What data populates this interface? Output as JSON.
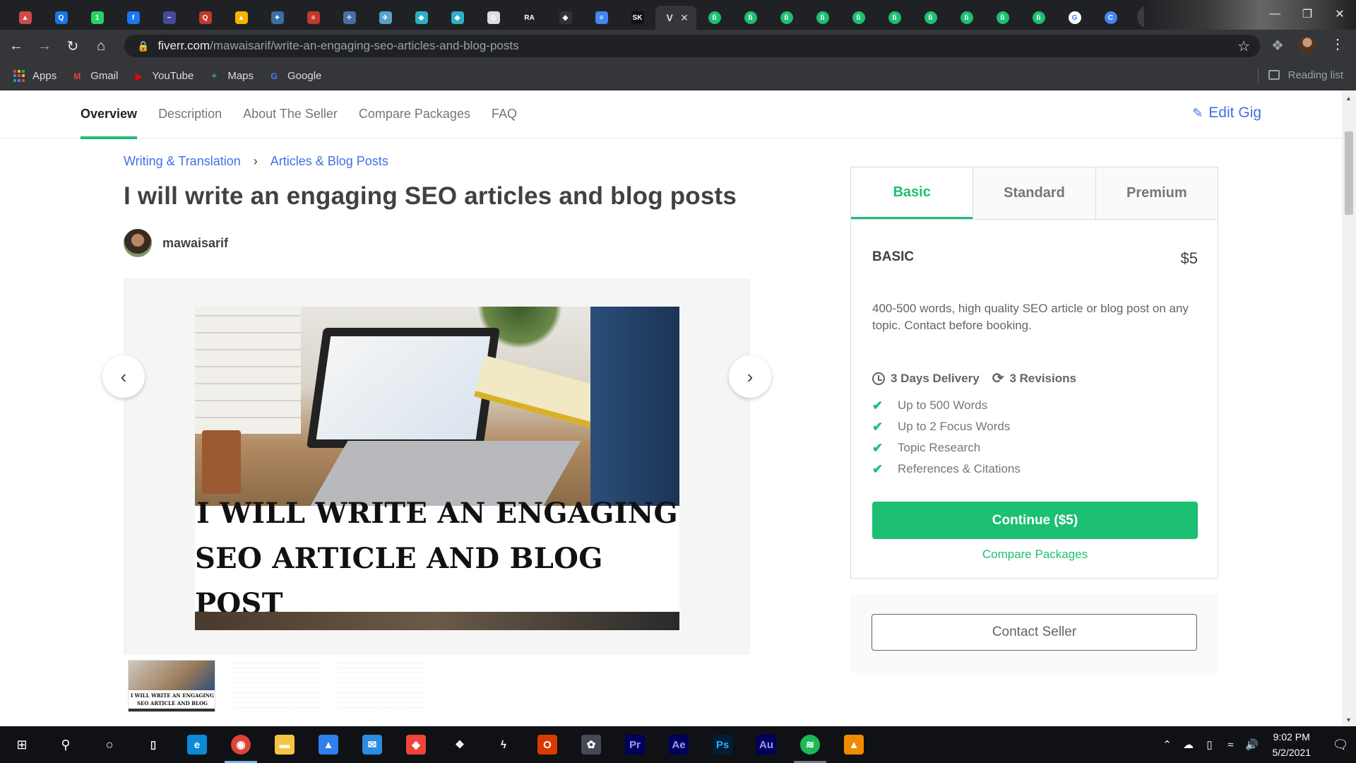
{
  "browser": {
    "tabs": [
      {
        "icon": "tab-favicon",
        "color": "#d04a4a",
        "glyph": "▲"
      },
      {
        "icon": "tab-favicon",
        "color": "#1a73e8",
        "glyph": "Q"
      },
      {
        "icon": "tab-favicon",
        "color": "#25d366",
        "glyph": "1"
      },
      {
        "icon": "tab-favicon",
        "color": "#1877f2",
        "glyph": "f"
      },
      {
        "icon": "tab-favicon",
        "color": "#444a9a",
        "glyph": "~"
      },
      {
        "icon": "tab-favicon",
        "color": "#c0392b",
        "glyph": "Q"
      },
      {
        "icon": "tab-favicon",
        "color": "#f4b400",
        "glyph": "▲"
      },
      {
        "icon": "tab-favicon",
        "color": "#3a6ea5",
        "glyph": "✦"
      },
      {
        "icon": "tab-favicon",
        "color": "#c0392b",
        "glyph": "≡"
      },
      {
        "icon": "tab-favicon",
        "color": "#4a6fa5",
        "glyph": "✧"
      },
      {
        "icon": "tab-favicon",
        "color": "#5aa0c8",
        "glyph": "✈"
      },
      {
        "icon": "tab-favicon",
        "color": "#2bb0c8",
        "glyph": "◆"
      },
      {
        "icon": "tab-favicon",
        "color": "#2bb0c8",
        "glyph": "◆"
      },
      {
        "icon": "tab-favicon",
        "color": "#dadce0",
        "glyph": "◎"
      },
      {
        "icon": "tab-favicon",
        "color": "#222222",
        "glyph": "RA"
      },
      {
        "icon": "tab-favicon",
        "color": "#333333",
        "glyph": "◆"
      },
      {
        "icon": "tab-favicon",
        "color": "#4285f4",
        "glyph": "≡"
      },
      {
        "icon": "tab-favicon",
        "color": "#111111",
        "glyph": "SK"
      }
    ],
    "active_tab_glyph": "V",
    "fiverr_tab_glyph": "fi",
    "fiverr_tab_count": 10,
    "trailing_tabs": [
      {
        "color": "#ffffff",
        "glyph": "G"
      },
      {
        "color": "#4285f4",
        "glyph": "C"
      }
    ],
    "url_domain": "fiverr.com",
    "url_path": "/mawaisarif/write-an-engaging-seo-articles-and-blog-posts",
    "bookmarks": [
      {
        "label": "Apps",
        "icon": "apps-grid-icon"
      },
      {
        "label": "Gmail",
        "icon": "gmail-icon"
      },
      {
        "label": "YouTube",
        "icon": "youtube-icon"
      },
      {
        "label": "Maps",
        "icon": "maps-icon"
      },
      {
        "label": "Google",
        "icon": "google-icon"
      }
    ],
    "reading_list": "Reading list"
  },
  "subnav": {
    "items": [
      "Overview",
      "Description",
      "About The Seller",
      "Compare Packages",
      "FAQ"
    ],
    "active": "Overview",
    "edit_gig": "Edit Gig"
  },
  "gig": {
    "breadcrumb": [
      "Writing & Translation",
      "Articles & Blog Posts"
    ],
    "title": "I will write an engaging SEO articles and blog posts",
    "seller_name": "mawaisarif",
    "image_caption_line1": "I WILL WRITE AN ENGAGING",
    "image_caption_line2": "SEO ARTICLE AND BLOG POST",
    "thumb_caption_line1": "I WILL WRITE AN ENGAGING",
    "thumb_caption_line2": "SEO ARTICLE AND BLOG POST"
  },
  "package": {
    "tabs": [
      "Basic",
      "Standard",
      "Premium"
    ],
    "active_tab": "Basic",
    "name": "BASIC",
    "price": "$5",
    "description": "400-500 words, high quality SEO article or blog post on any topic. Contact before booking.",
    "delivery": "3 Days Delivery",
    "revisions": "3 Revisions",
    "features": [
      "Up to 500 Words",
      "Up to 2 Focus Words",
      "Topic Research",
      "References & Citations"
    ],
    "continue_label": "Continue ($5)",
    "compare_label": "Compare Packages",
    "contact_label": "Contact Seller"
  },
  "colors": {
    "fiverr_green": "#1dbf73",
    "link_blue": "#446ee7"
  },
  "taskbar": {
    "apps": [
      {
        "name": "task-view",
        "glyph": "▯",
        "color": "#0f1115"
      },
      {
        "name": "edge",
        "glyph": "e",
        "color": "#0c8ad6"
      },
      {
        "name": "chrome",
        "glyph": "◉",
        "color": "#db4437"
      },
      {
        "name": "file-explorer",
        "glyph": "▬",
        "color": "#f4c542"
      },
      {
        "name": "app-blue",
        "glyph": "▲",
        "color": "#2f80ed"
      },
      {
        "name": "mail",
        "glyph": "✉",
        "color": "#2b8de0"
      },
      {
        "name": "anydesk",
        "glyph": "◆",
        "color": "#ef443b"
      },
      {
        "name": "dropbox",
        "glyph": "❖",
        "color": "#0f1115"
      },
      {
        "name": "app-bolt",
        "glyph": "ϟ",
        "color": "#0f1115"
      },
      {
        "name": "office",
        "glyph": "O",
        "color": "#d83b01"
      },
      {
        "name": "davinci",
        "glyph": "✿",
        "color": "#444a54"
      },
      {
        "name": "premiere",
        "glyph": "Pr",
        "color": "#00005b"
      },
      {
        "name": "after-effects",
        "glyph": "Ae",
        "color": "#00005b"
      },
      {
        "name": "photoshop",
        "glyph": "Ps",
        "color": "#001e36"
      },
      {
        "name": "audition",
        "glyph": "Au",
        "color": "#00005b"
      },
      {
        "name": "spotify",
        "glyph": "≋",
        "color": "#1db954"
      },
      {
        "name": "vlc",
        "glyph": "▲",
        "color": "#f08a00"
      }
    ],
    "time": "9:02 PM",
    "date": "5/2/2021"
  }
}
